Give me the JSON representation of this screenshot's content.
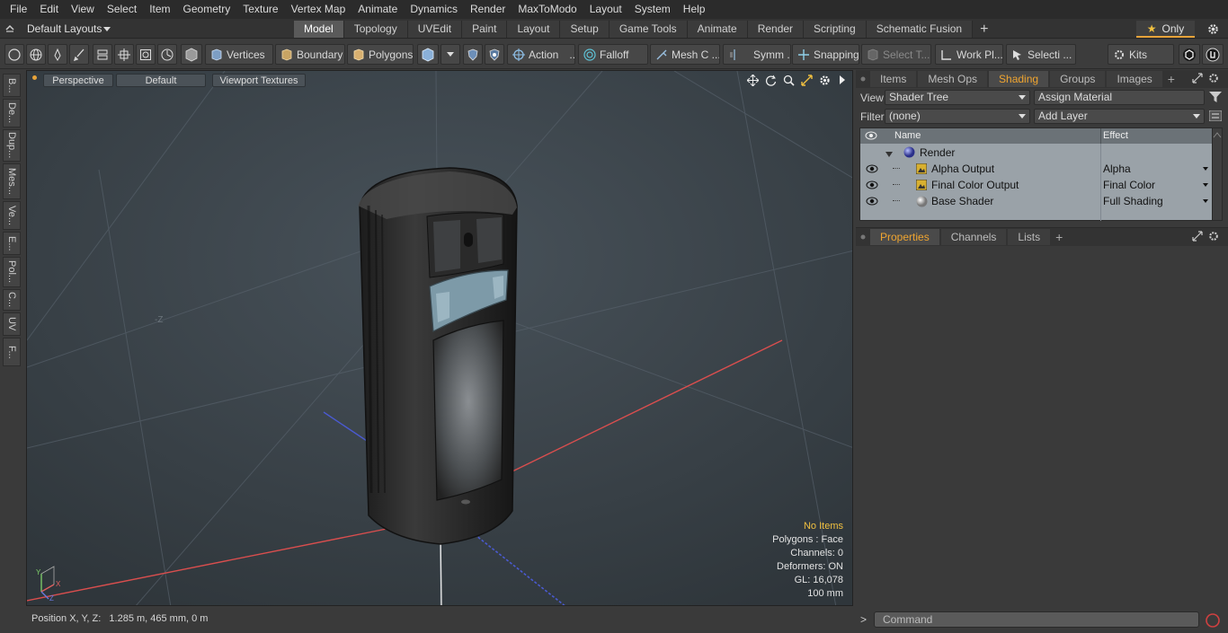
{
  "menu": [
    "File",
    "Edit",
    "View",
    "Select",
    "Item",
    "Geometry",
    "Texture",
    "Vertex Map",
    "Animate",
    "Dynamics",
    "Render",
    "MaxToModo",
    "Layout",
    "System",
    "Help"
  ],
  "layout_selector": "Default Layouts",
  "tabs": [
    "Model",
    "Topology",
    "UVEdit",
    "Paint",
    "Layout",
    "Setup",
    "Game Tools",
    "Animate",
    "Render",
    "Scripting",
    "Schematic Fusion"
  ],
  "active_tab": "Model",
  "only_label": "Only",
  "toolbar": {
    "vertices": "Vertices",
    "boundary": "Boundary",
    "polygons": "Polygons",
    "action": "Action",
    "action_more": "...",
    "falloff": "Falloff",
    "mesh_c": "Mesh C ...",
    "symm": "Symm ...",
    "snapping": "Snapping",
    "select_t": "Select T...",
    "work_pl": "Work Pl...",
    "selecti": "Selecti ...",
    "kits": "Kits"
  },
  "left_tabs": [
    "B...",
    "De...",
    "Dup...",
    "Mes...",
    "Ve...",
    "E...",
    "Pol...",
    "C...",
    "UV",
    "F..."
  ],
  "viewport": {
    "perspective": "Perspective",
    "default": "Default",
    "viewport_textures": "Viewport Textures",
    "axis_label": "-Z",
    "gizmo": {
      "y": "Y",
      "x": "X",
      "z": "Z"
    },
    "hud": {
      "no_items": "No Items",
      "polygons": "Polygons : Face",
      "channels": "Channels: 0",
      "deformers": "Deformers: ON",
      "gl": "GL: 16,078",
      "scale": "100 mm"
    }
  },
  "status": "Position X, Y, Z:   1.285 m, 465 mm, 0 m",
  "right_panel": {
    "tabs": [
      "Items",
      "Mesh Ops",
      "Shading",
      "Groups",
      "Images"
    ],
    "active_tab": "Shading",
    "view_label": "View",
    "view_value": "Shader Tree",
    "assign_material": "Assign Material",
    "filter_label": "Filter",
    "filter_value": "(none)",
    "add_layer": "Add Layer",
    "columns": {
      "name": "Name",
      "effect": "Effect"
    },
    "rows": [
      {
        "name": "Render",
        "effect": ""
      },
      {
        "name": "Alpha Output",
        "effect": "Alpha"
      },
      {
        "name": "Final Color Output",
        "effect": "Final Color"
      },
      {
        "name": "Base Shader",
        "effect": "Full Shading"
      }
    ]
  },
  "properties_tabs": [
    "Properties",
    "Channels",
    "Lists"
  ],
  "properties_active": "Properties",
  "command_placeholder": "Command"
}
